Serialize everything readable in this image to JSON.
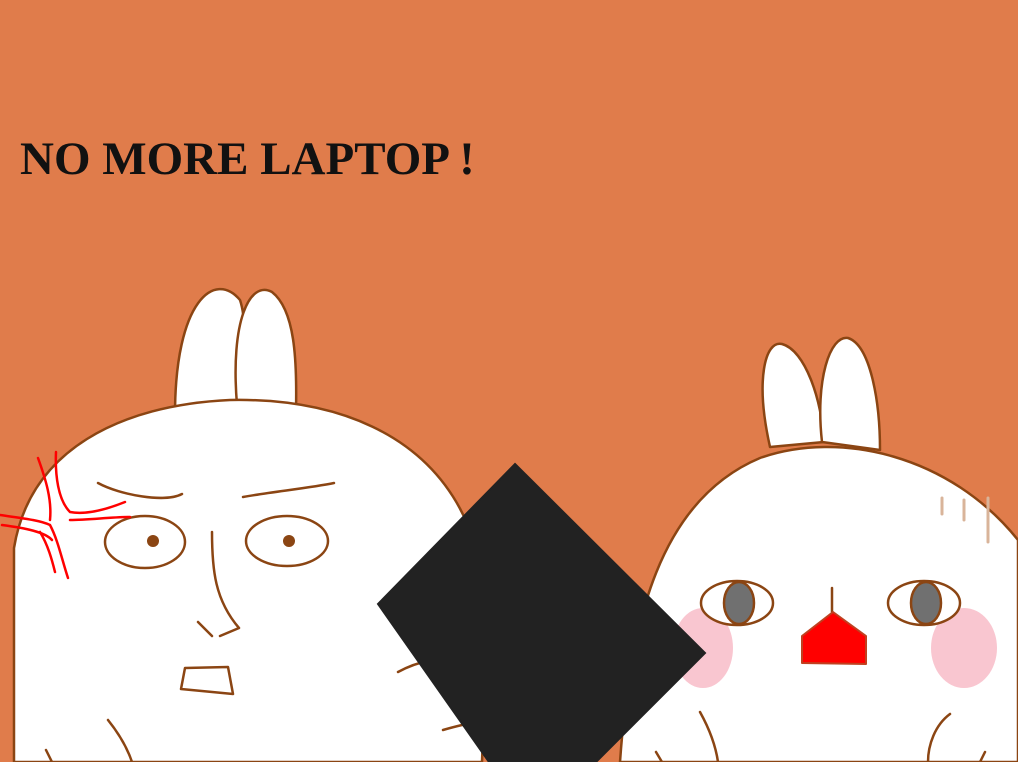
{
  "caption": {
    "text": "NO MORE LAPTOP !"
  },
  "palette": {
    "background": "#e07c4b",
    "outline": "#8b4513",
    "bunny_fill": "#ffffff",
    "anger_mark": "#ff0000",
    "laptop": "#222222",
    "blush": "#f9c6d0",
    "nose": "#ff0000",
    "pupil": "#707070"
  },
  "characters": [
    {
      "name": "angry-bunny",
      "expression": "angry"
    },
    {
      "name": "shocked-bunny",
      "expression": "shocked"
    }
  ],
  "props": [
    {
      "name": "laptop",
      "icon": "black-diamond"
    }
  ]
}
